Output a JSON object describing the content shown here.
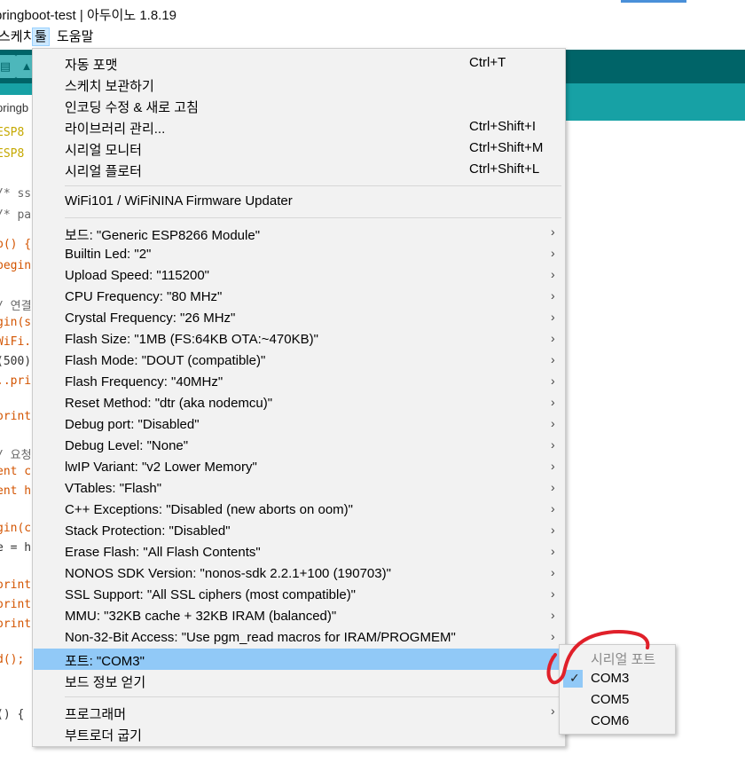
{
  "window": {
    "title": "pringboot-test | 아두이노 1.8.19"
  },
  "menubar": {
    "items": [
      "스케치",
      "툴",
      "도움말"
    ]
  },
  "tab": {
    "label": "pringb"
  },
  "code_lines": [
    {
      "text": "ESP8",
      "color": "#c5a800"
    },
    {
      "text": "ESP8",
      "color": "#c5a800"
    },
    {
      "text": "/* ss",
      "color": "#666666"
    },
    {
      "text": "/* pa",
      "color": "#666666"
    },
    {
      "text": "p() {",
      "color": "#d35400"
    },
    {
      "text": "begin",
      "color": "#d35400"
    },
    {
      "text": "/ 연결",
      "color": "#666666"
    },
    {
      "text": "gin(s",
      "color": "#d35400"
    },
    {
      "text": "WiFi.",
      "color": "#d35400"
    },
    {
      "text": "(500)",
      "color": "#333333"
    },
    {
      "text": "..pri",
      "color": "#d35400"
    },
    {
      "text": "orint",
      "color": "#d35400"
    },
    {
      "text": "/ 요청",
      "color": "#666666"
    },
    {
      "text": "ent c",
      "color": "#d35400"
    },
    {
      "text": "ent h",
      "color": "#d35400"
    },
    {
      "text": "gin(c",
      "color": "#d35400"
    },
    {
      "text": "e = h",
      "color": "#333333"
    },
    {
      "text": "orint",
      "color": "#d35400"
    },
    {
      "text": "orint",
      "color": "#d35400"
    },
    {
      "text": "orint",
      "color": "#d35400"
    },
    {
      "text": "d();",
      "color": "#d35400"
    },
    {
      "text": "() {",
      "color": "#333333"
    }
  ],
  "tools_menu": {
    "group1": [
      {
        "label": "자동 포맷",
        "shortcut": "Ctrl+T"
      },
      {
        "label": "스케치 보관하기",
        "shortcut": ""
      },
      {
        "label": "인코딩 수정 & 새로 고침",
        "shortcut": ""
      },
      {
        "label": "라이브러리 관리...",
        "shortcut": "Ctrl+Shift+I"
      },
      {
        "label": "시리얼 모니터",
        "shortcut": "Ctrl+Shift+M"
      },
      {
        "label": "시리얼 플로터",
        "shortcut": "Ctrl+Shift+L"
      }
    ],
    "group2": [
      {
        "label": "WiFi101 / WiFiNINA Firmware Updater"
      }
    ],
    "group3": [
      {
        "label": "보드: \"Generic ESP8266 Module\"",
        "arrow": true
      },
      {
        "label": "Builtin Led: \"2\"",
        "arrow": true
      },
      {
        "label": "Upload Speed: \"115200\"",
        "arrow": true
      },
      {
        "label": "CPU Frequency: \"80 MHz\"",
        "arrow": true
      },
      {
        "label": "Crystal Frequency: \"26 MHz\"",
        "arrow": true
      },
      {
        "label": "Flash Size: \"1MB (FS:64KB OTA:~470KB)\"",
        "arrow": true
      },
      {
        "label": "Flash Mode: \"DOUT (compatible)\"",
        "arrow": true
      },
      {
        "label": "Flash Frequency: \"40MHz\"",
        "arrow": true
      },
      {
        "label": "Reset Method: \"dtr (aka nodemcu)\"",
        "arrow": true
      },
      {
        "label": "Debug port: \"Disabled\"",
        "arrow": true
      },
      {
        "label": "Debug Level: \"None\"",
        "arrow": true
      },
      {
        "label": "lwIP Variant: \"v2 Lower Memory\"",
        "arrow": true
      },
      {
        "label": "VTables: \"Flash\"",
        "arrow": true
      },
      {
        "label": "C++ Exceptions: \"Disabled (new aborts on oom)\"",
        "arrow": true
      },
      {
        "label": "Stack Protection: \"Disabled\"",
        "arrow": true
      },
      {
        "label": "Erase Flash: \"All Flash Contents\"",
        "arrow": true
      },
      {
        "label": "NONOS SDK Version: \"nonos-sdk 2.2.1+100 (190703)\"",
        "arrow": true
      },
      {
        "label": "SSL Support: \"All SSL ciphers (most compatible)\"",
        "arrow": true
      },
      {
        "label": "MMU: \"32KB cache + 32KB IRAM (balanced)\"",
        "arrow": true
      },
      {
        "label": "Non-32-Bit Access: \"Use pgm_read macros for IRAM/PROGMEM\"",
        "arrow": true
      },
      {
        "label": "포트: \"COM3\"",
        "arrow": true,
        "highlight": true
      },
      {
        "label": "보드 정보 얻기",
        "arrow": false
      }
    ],
    "group4": [
      {
        "label": "프로그래머",
        "arrow": true
      },
      {
        "label": "부트로더 굽기",
        "arrow": false
      }
    ]
  },
  "port_submenu": {
    "header": "시리얼 포트",
    "ports": [
      {
        "label": "COM3",
        "checked": true
      },
      {
        "label": "COM5",
        "checked": false
      },
      {
        "label": "COM6",
        "checked": false
      }
    ]
  },
  "colors": {
    "toolbar": "#006468",
    "tabbar": "#17a1a5",
    "highlight": "#91c9f7",
    "annotation": "#e0202a"
  }
}
